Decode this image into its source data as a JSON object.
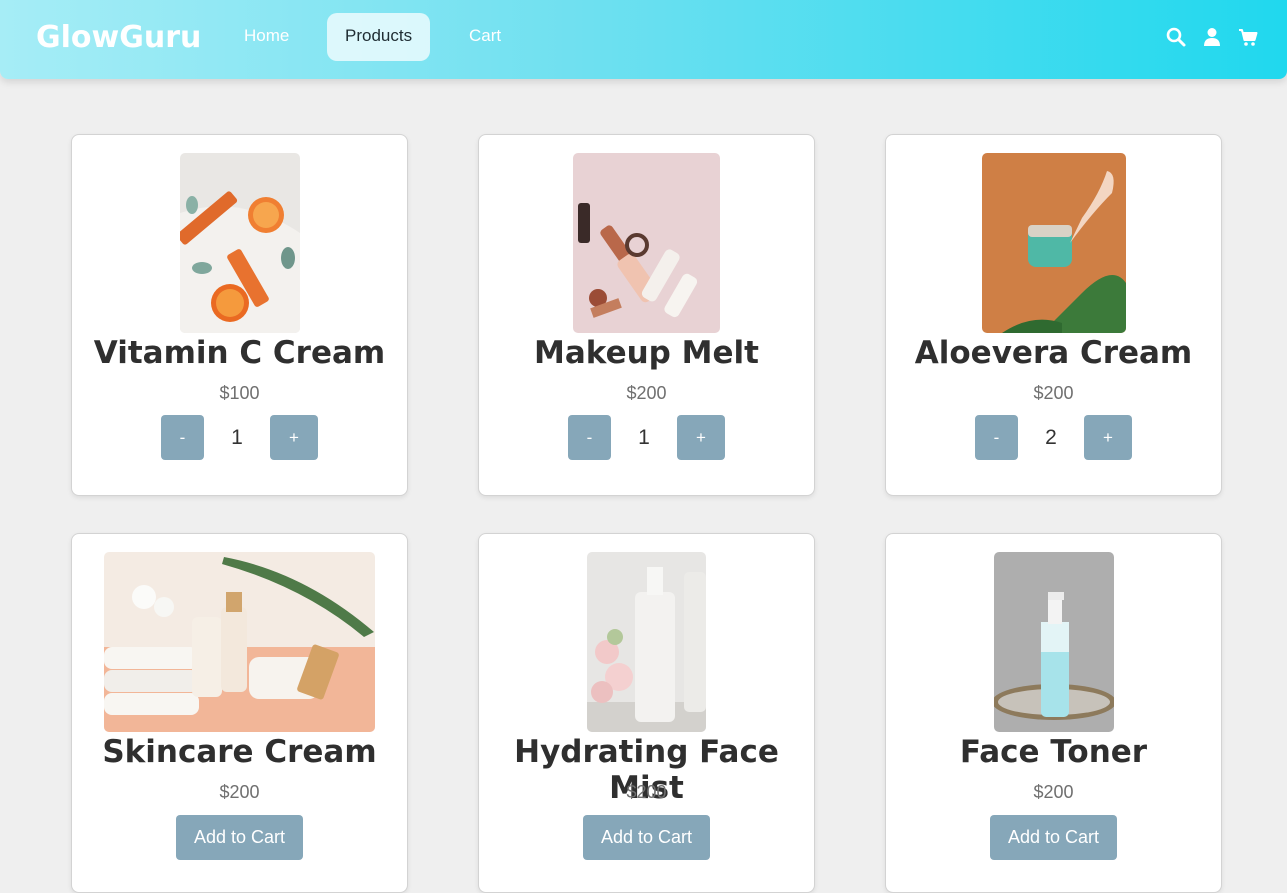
{
  "brand": "GlowGuru",
  "nav": {
    "home": "Home",
    "products": "Products",
    "cart": "Cart"
  },
  "colors": {
    "accent": "#20d8ee",
    "button": "#86a7b9"
  },
  "icons": {
    "search": "search-icon",
    "user": "user-icon",
    "cart": "cart-icon"
  },
  "products": [
    {
      "name": "Vitamin C Cream",
      "price": "$100",
      "quantity": "1",
      "minus": "-",
      "plus": "+"
    },
    {
      "name": "Makeup Melt",
      "price": "$200",
      "quantity": "1",
      "minus": "-",
      "plus": "+"
    },
    {
      "name": "Aloevera Cream",
      "price": "$200",
      "quantity": "2",
      "minus": "-",
      "plus": "+"
    },
    {
      "name": "Skincare Cream",
      "price": "$200",
      "add_label": "Add to Cart"
    },
    {
      "name": "Hydrating Face Mist",
      "price": "$200",
      "add_label": "Add to Cart"
    },
    {
      "name": "Face Toner",
      "price": "$200",
      "add_label": "Add to Cart"
    }
  ]
}
